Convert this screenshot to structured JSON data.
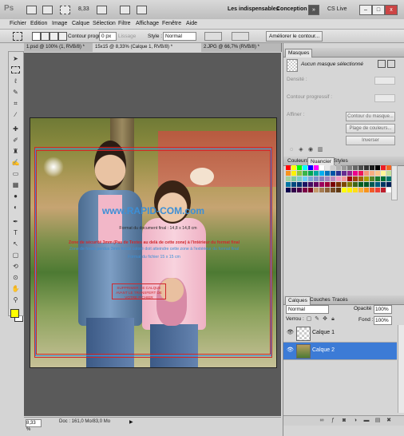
{
  "app": {
    "logo": "Ps",
    "zoom": "8,33",
    "workspaces": [
      "Les indispensables",
      "Conception"
    ],
    "more": "»",
    "cslive": "CS Live",
    "window_buttons": [
      "–",
      "□",
      "x"
    ]
  },
  "menu": [
    "Fichier",
    "Edition",
    "Image",
    "Calque",
    "Sélection",
    "Filtre",
    "Affichage",
    "Fenêtre",
    "Aide"
  ],
  "options": {
    "contour_label": "Contour progr. :",
    "contour_value": "0 px",
    "lissage": "Lissage",
    "style_label": "Style :",
    "style_value": "Normal",
    "improve_button": "Améliorer le contour..."
  },
  "tabs": [
    {
      "label": "1.psd @ 100% (1, RVB/8) *",
      "close": "×"
    },
    {
      "label": "15x15 @ 8,33% (Calque 1, RVB/8) *",
      "close": "×"
    },
    {
      "label": "2.JPG @ 66,7% (RVB/8) *",
      "close": "×"
    }
  ],
  "canvas": {
    "watermark": "www.RAPID-COM.com",
    "format_final": "Format du document final : 14,8 x 14,8 cm",
    "securite": "Zone de sécurité 3mm (Pas de Textes au delà de cette zone) à l'intérieur du format final",
    "fonds_perdus": "Zone de fonds perdus 3mm fonds coloré doit atteindre cette zone à l'extérieur du format final",
    "format_fichier": "Format du fichier 15 x 15 cm",
    "box_text": "SUPPRIMER CE CALQUE AVANT LE TRANSFERT DE VOTRE FICHIER"
  },
  "status": {
    "zoom": "8,33 %",
    "doc": "Doc : 161,0 Mo/83,0 Mo",
    "arrow": "▶"
  },
  "masques": {
    "title": "Masques",
    "mask_label": "Aucun masque sélectionné",
    "densite": "Densité :",
    "contour": "Contour progressif :",
    "affiner": "Affiner :",
    "btn_contour": "Contour du masque...",
    "btn_plage": "Plage de couleurs...",
    "btn_inverser": "Inverser"
  },
  "swatch_tabs": [
    "Couleurs",
    "Nuancier",
    "Styles"
  ],
  "swatches": [
    "#ff0000",
    "#ffff00",
    "#00ff00",
    "#00ffff",
    "#0000ff",
    "#ff00ff",
    "#ffffff",
    "#e6e6e6",
    "#cccccc",
    "#b3b3b3",
    "#999999",
    "#808080",
    "#666666",
    "#4d4d4d",
    "#333333",
    "#1a1a1a",
    "#000000",
    "#ed1c24",
    "#f26522",
    "#f7941d",
    "#fff200",
    "#8dc63f",
    "#39b54a",
    "#00a651",
    "#00a99d",
    "#00aeef",
    "#0072bc",
    "#0054a6",
    "#2e3192",
    "#662d91",
    "#92278f",
    "#ec008c",
    "#ed145b",
    "#f69679",
    "#f9ad81",
    "#fdc68a",
    "#fff799",
    "#c4df9b",
    "#a3d39c",
    "#82ca9c",
    "#7accc8",
    "#6dcff6",
    "#7da7d9",
    "#8393ca",
    "#8781bd",
    "#a187be",
    "#bd8cbf",
    "#f49ac1",
    "#f5989d",
    "#9e0b0f",
    "#a0410d",
    "#a36209",
    "#aba000",
    "#598527",
    "#1a7b30",
    "#007236",
    "#00746b",
    "#0076a3",
    "#004a80",
    "#003471",
    "#1b1464",
    "#440e62",
    "#630460",
    "#9e005d",
    "#9e0039",
    "#790000",
    "#7b2e00",
    "#7d4900",
    "#827b00",
    "#406618",
    "#005e20",
    "#005826",
    "#005952",
    "#005b7f",
    "#003663",
    "#002157",
    "#0d004c",
    "#32004b",
    "#4b0049",
    "#7b0046",
    "#7a0026",
    "#c69c6d",
    "#a67c52",
    "#8c6239",
    "#754c24",
    "#603913",
    "#ffff00",
    "#fff200",
    "#ffde17",
    "#fbb040",
    "#f7941d",
    "#f15a29",
    "#ef4136",
    "#be1e2d",
    "#ffffff"
  ],
  "calques": {
    "tabs": [
      "Calques",
      "Couches",
      "Tracés"
    ],
    "mode": "Normal",
    "opacite_label": "Opacité :",
    "opacite": "100%",
    "verrou_label": "Verrou :",
    "fond_label": "Fond :",
    "fond": "100%",
    "layers": [
      "Calque 1",
      "Calque 2"
    ]
  },
  "footer_icons": [
    "link-icon",
    "fx-icon",
    "mask-icon",
    "adjust-icon",
    "folder-icon",
    "new-layer-icon",
    "trash-icon"
  ]
}
